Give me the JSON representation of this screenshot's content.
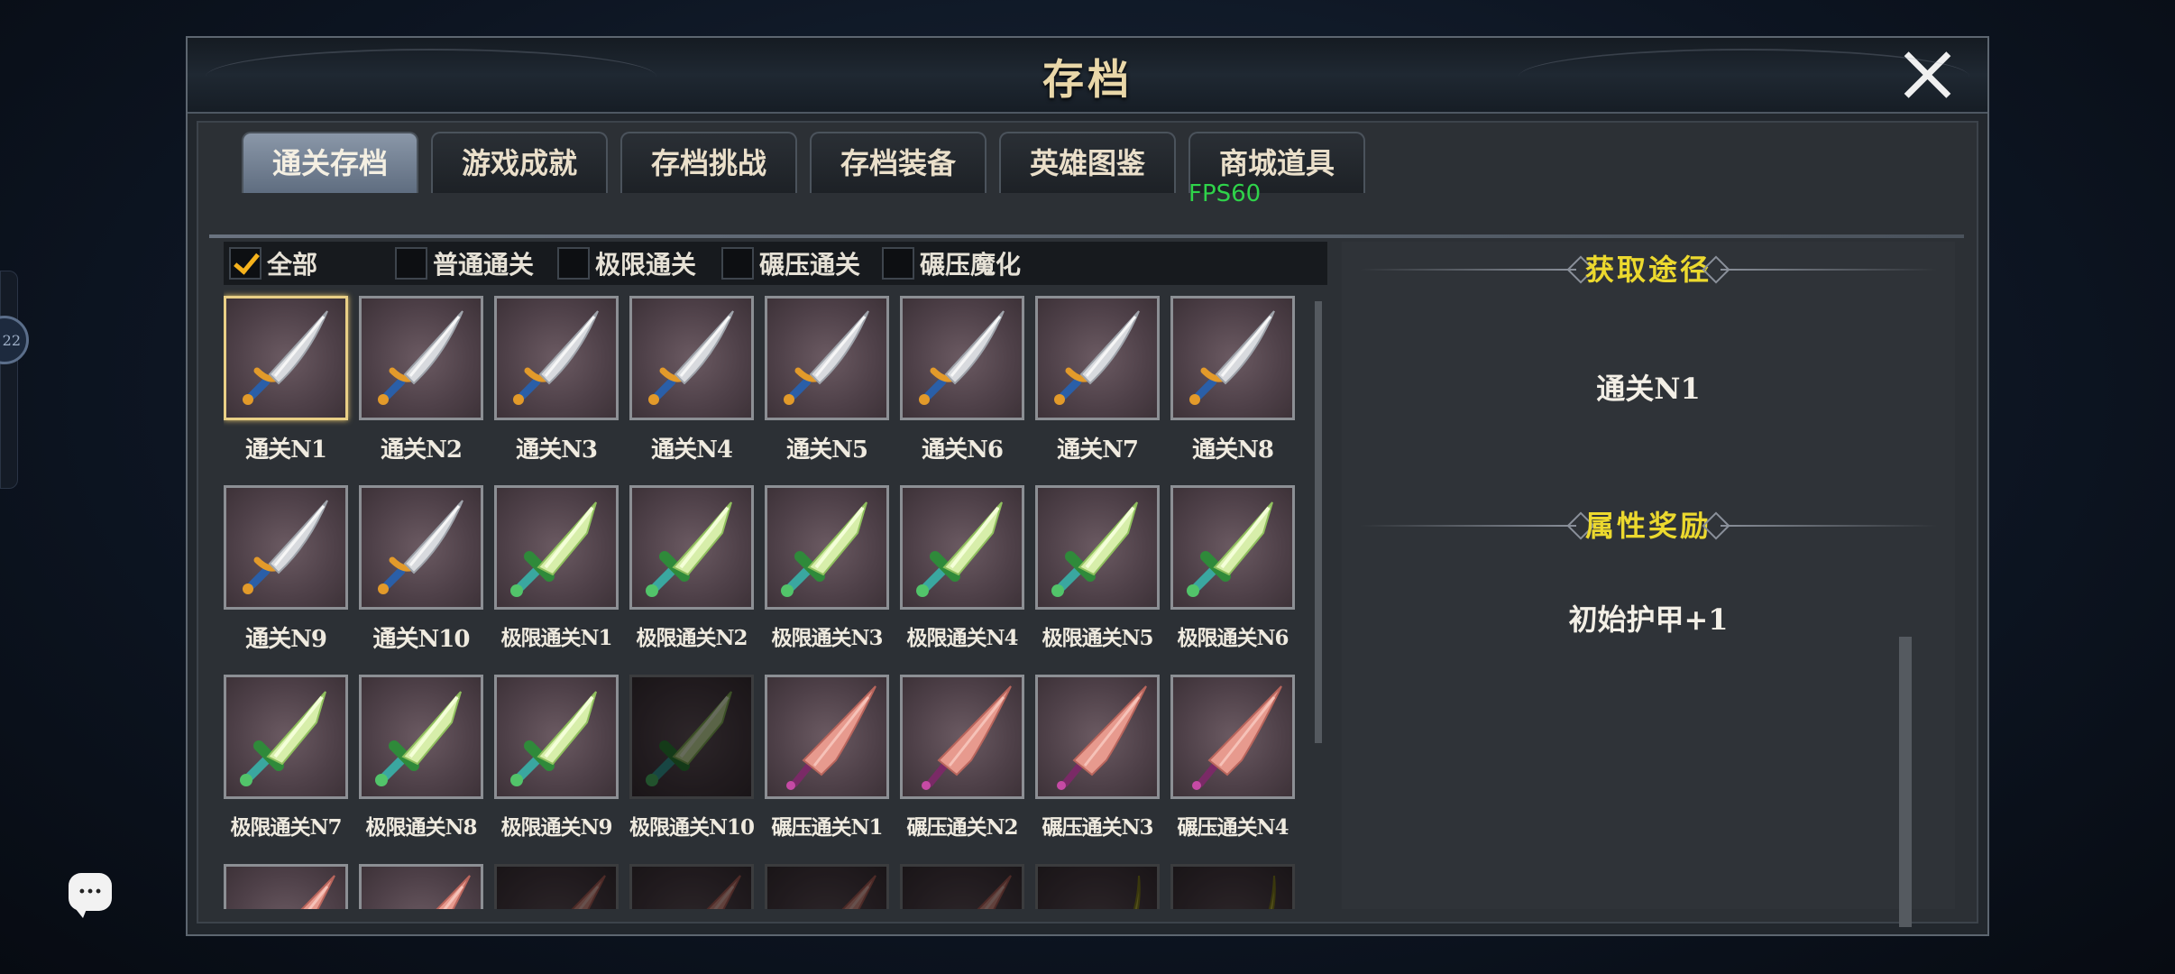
{
  "window": {
    "title": "存档"
  },
  "tabs": [
    {
      "label": "通关存档",
      "active": true
    },
    {
      "label": "游戏成就",
      "active": false
    },
    {
      "label": "存档挑战",
      "active": false
    },
    {
      "label": "存档装备",
      "active": false
    },
    {
      "label": "英雄图鉴",
      "active": false
    },
    {
      "label": "商城道具",
      "active": false
    }
  ],
  "fps_overlay": "FPS60",
  "side_badge": "22",
  "filters": [
    {
      "label": "全部",
      "checked": true
    },
    {
      "label": "普通通关",
      "checked": false
    },
    {
      "label": "极限通关",
      "checked": false
    },
    {
      "label": "碾压通关",
      "checked": false
    },
    {
      "label": "碾压魔化",
      "checked": false
    }
  ],
  "items": [
    {
      "label": "通关N1",
      "weapon": "silver-dagger-icon",
      "selected": true,
      "locked": false
    },
    {
      "label": "通关N2",
      "weapon": "silver-dagger-icon",
      "selected": false,
      "locked": false
    },
    {
      "label": "通关N3",
      "weapon": "silver-dagger-icon",
      "selected": false,
      "locked": false
    },
    {
      "label": "通关N4",
      "weapon": "silver-dagger-icon",
      "selected": false,
      "locked": false
    },
    {
      "label": "通关N5",
      "weapon": "silver-dagger-icon",
      "selected": false,
      "locked": false
    },
    {
      "label": "通关N6",
      "weapon": "silver-dagger-icon",
      "selected": false,
      "locked": false
    },
    {
      "label": "通关N7",
      "weapon": "silver-dagger-icon",
      "selected": false,
      "locked": false
    },
    {
      "label": "通关N8",
      "weapon": "silver-dagger-icon",
      "selected": false,
      "locked": false
    },
    {
      "label": "通关N9",
      "weapon": "silver-dagger-icon",
      "selected": false,
      "locked": false
    },
    {
      "label": "通关N10",
      "weapon": "silver-dagger-icon",
      "selected": false,
      "locked": false
    },
    {
      "label": "极限通关N1",
      "weapon": "jade-sword-icon",
      "selected": false,
      "locked": false
    },
    {
      "label": "极限通关N2",
      "weapon": "jade-sword-icon",
      "selected": false,
      "locked": false
    },
    {
      "label": "极限通关N3",
      "weapon": "jade-sword-icon",
      "selected": false,
      "locked": false
    },
    {
      "label": "极限通关N4",
      "weapon": "jade-sword-icon",
      "selected": false,
      "locked": false
    },
    {
      "label": "极限通关N5",
      "weapon": "jade-sword-icon",
      "selected": false,
      "locked": false
    },
    {
      "label": "极限通关N6",
      "weapon": "jade-sword-icon",
      "selected": false,
      "locked": false
    },
    {
      "label": "极限通关N7",
      "weapon": "jade-sword-icon",
      "selected": false,
      "locked": false
    },
    {
      "label": "极限通关N8",
      "weapon": "jade-sword-icon",
      "selected": false,
      "locked": false
    },
    {
      "label": "极限通关N9",
      "weapon": "jade-sword-icon",
      "selected": false,
      "locked": false
    },
    {
      "label": "极限通关N10",
      "weapon": "jade-sword-icon",
      "selected": false,
      "locked": true
    },
    {
      "label": "碾压通关N1",
      "weapon": "crimson-blade-icon",
      "selected": false,
      "locked": false
    },
    {
      "label": "碾压通关N2",
      "weapon": "crimson-blade-icon",
      "selected": false,
      "locked": false
    },
    {
      "label": "碾压通关N3",
      "weapon": "crimson-blade-icon",
      "selected": false,
      "locked": false
    },
    {
      "label": "碾压通关N4",
      "weapon": "crimson-blade-icon",
      "selected": false,
      "locked": false
    },
    {
      "label": "",
      "weapon": "crimson-blade-icon",
      "selected": false,
      "locked": false
    },
    {
      "label": "",
      "weapon": "crimson-blade-icon",
      "selected": false,
      "locked": false
    },
    {
      "label": "",
      "weapon": "crimson-blade-icon",
      "selected": false,
      "locked": true
    },
    {
      "label": "",
      "weapon": "crimson-blade-icon",
      "selected": false,
      "locked": true
    },
    {
      "label": "",
      "weapon": "crimson-blade-icon",
      "selected": false,
      "locked": true
    },
    {
      "label": "",
      "weapon": "crimson-blade-icon",
      "selected": false,
      "locked": true
    },
    {
      "label": "",
      "weapon": "golden-scimitar-icon",
      "selected": false,
      "locked": true
    },
    {
      "label": "",
      "weapon": "golden-scimitar-icon",
      "selected": false,
      "locked": true
    }
  ],
  "detail": {
    "obtain_heading": "获取途径",
    "obtain_value": "通关N1",
    "reward_heading": "属性奖励",
    "reward_value": "初始护甲+1"
  },
  "colors": {
    "accent_gold": "#e9d7a8",
    "heading_yellow": "#ecd92e",
    "checkmark": "#f5b21c",
    "fps_green": "#2fd34a",
    "active_tab": "#7a889a"
  }
}
